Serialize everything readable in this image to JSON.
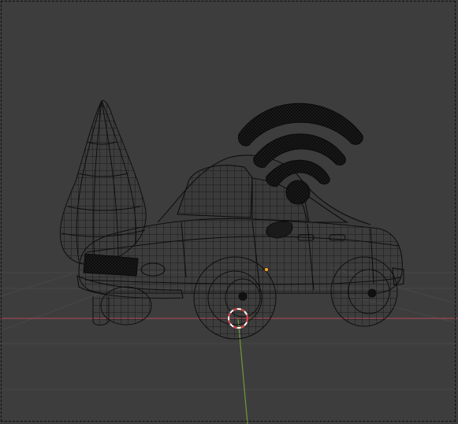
{
  "viewport": {
    "mode": "wireframe",
    "colors": {
      "background": "#3d3d3d",
      "wire": "#0e0e0e",
      "grid": "#474747",
      "x_axis": "#9a4a52",
      "y_axis": "#6f9a3a",
      "cursor_red": "#d63a3a",
      "cursor_white": "#ffffff",
      "origin_dot": "#f0a030"
    },
    "objects": [
      {
        "name": "car"
      },
      {
        "name": "tree"
      },
      {
        "name": "wifi-symbol"
      }
    ]
  }
}
